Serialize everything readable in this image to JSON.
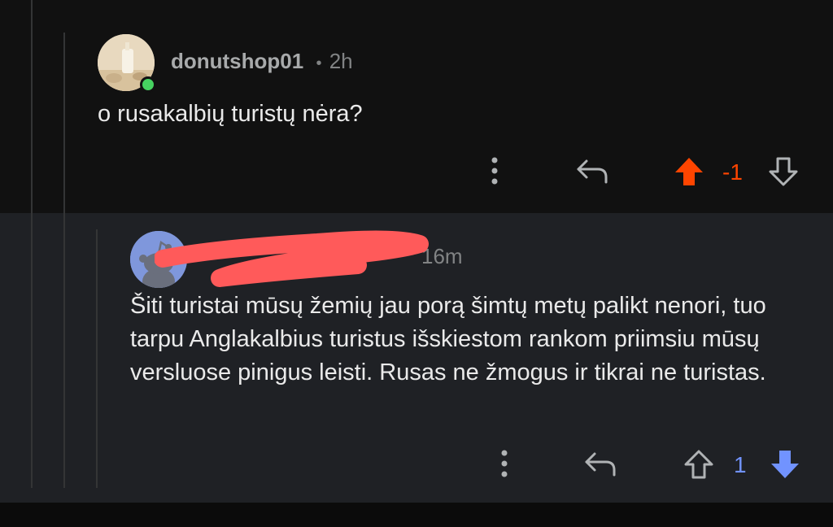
{
  "comments": [
    {
      "username": "donutshop01",
      "separator": "•",
      "time": "2h",
      "body": "o rusakalbių turistų nėra?",
      "score": "-1",
      "vote_state": "upvoted",
      "online": true
    },
    {
      "username": "",
      "separator": "",
      "time": "16m",
      "body": "Šiti turistai mūsų žemių jau porą šimtų metų palikt nenori, tuo tarpu Anglakalbius turistus išskiestom rankom priimsiu mūsų versluose pinigus leisti. Rusas ne žmogus ir tikrai ne turistas.",
      "score": "1",
      "vote_state": "downvoted"
    }
  ],
  "colors": {
    "upvote": "#ff4500",
    "downvote": "#7193ff",
    "online": "#46d160"
  },
  "icons": [
    "more-options-icon",
    "reply-icon",
    "upvote-arrow-icon",
    "downvote-arrow-icon",
    "snoo-avatar-icon"
  ]
}
